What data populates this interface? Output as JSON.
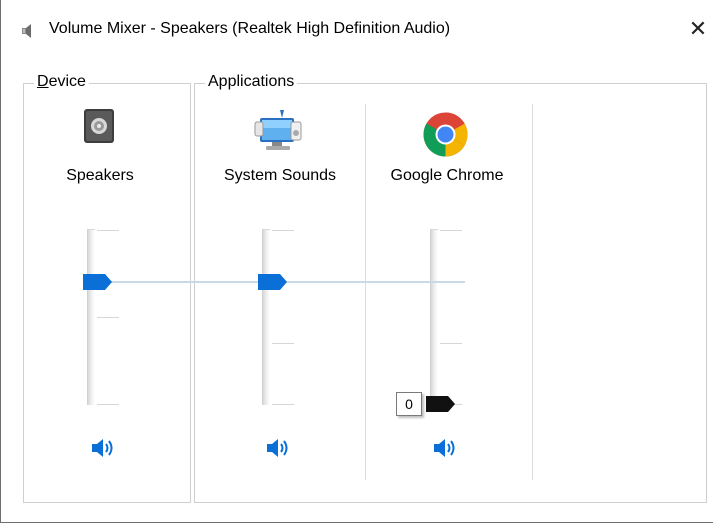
{
  "window": {
    "title": "Volume Mixer - Speakers (Realtek High Definition Audio)",
    "close_glyph": "✕"
  },
  "device_group": {
    "label_accel": "D",
    "label_rest": "evice",
    "device": {
      "name": "Speakers",
      "icon": "speaker-device-icon",
      "volume": 0.7,
      "muted": false
    }
  },
  "applications_group": {
    "label": "Applications",
    "apps": [
      {
        "name": "System Sounds",
        "icon": "system-sounds-icon",
        "volume": 0.7,
        "muted": false
      },
      {
        "name": "Google Chrome",
        "icon": "chrome-icon",
        "volume": 0.0,
        "muted": false,
        "tooltip_value": "0"
      }
    ]
  },
  "colors": {
    "accent": "#0a6fd6",
    "muted_thumb": "#111111",
    "link_line": "#c9d9e6"
  }
}
